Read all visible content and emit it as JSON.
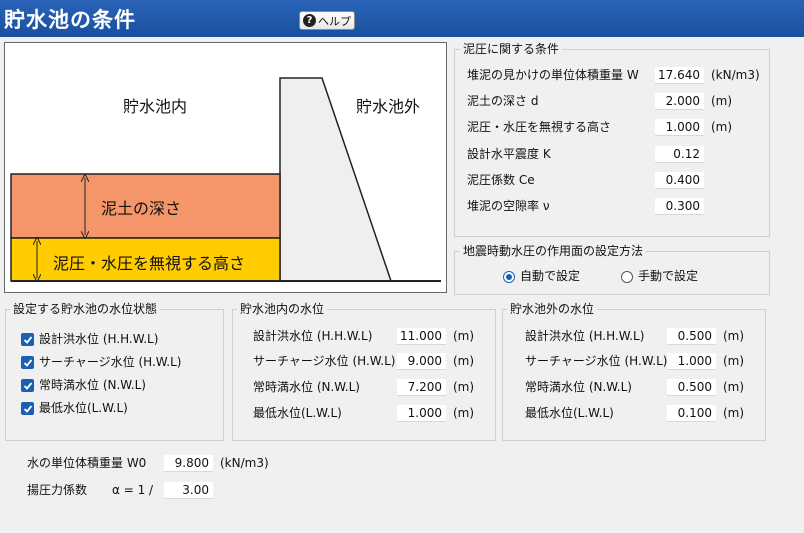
{
  "title": "貯水池の条件",
  "help_label": "ヘルプ",
  "diagram": {
    "inside_label": "貯水池内",
    "outside_label": "貯水池外",
    "mud_depth_label": "泥土の深さ",
    "ignore_height_label": "泥圧・水圧を無視する高さ",
    "colors": {
      "mud": "#f4956a",
      "ignore": "#ffcc00",
      "dam": "#efefef"
    }
  },
  "mud": {
    "legend": "泥圧に関する条件",
    "rows": [
      {
        "label": "堆泥の見かけの単位体積重量 W",
        "value": "17.640",
        "unit": "(kN/m3)"
      },
      {
        "label": "泥土の深さ d",
        "value": "2.000",
        "unit": "(m)"
      },
      {
        "label": "泥圧・水圧を無視する高さ",
        "value": "1.000",
        "unit": "(m)"
      },
      {
        "label": "設計水平震度 K",
        "value": "0.12",
        "unit": ""
      },
      {
        "label": "泥圧係数 Ce",
        "value": "0.400",
        "unit": ""
      },
      {
        "label": "堆泥の空隙率 ν",
        "value": "0.300",
        "unit": ""
      }
    ]
  },
  "seismic": {
    "legend": "地震時動水圧の作用面の設定方法",
    "auto_label": "自動で設定",
    "manual_label": "手動で設定",
    "selected": "auto"
  },
  "level_state": {
    "legend": "設定する貯水池の水位状態",
    "items": [
      {
        "label": "設計洪水位 (H.H.W.L)",
        "checked": true
      },
      {
        "label": "サーチャージ水位 (H.W.L)",
        "checked": true
      },
      {
        "label": "常時満水位 (N.W.L)",
        "checked": true
      },
      {
        "label": "最低水位(L.W.L)",
        "checked": true
      }
    ]
  },
  "inner_level": {
    "legend": "貯水池内の水位",
    "rows": [
      {
        "label": "設計洪水位 (H.H.W.L)",
        "value": "11.000",
        "unit": "(m)"
      },
      {
        "label": "サーチャージ水位 (H.W.L)",
        "value": "9.000",
        "unit": "(m)"
      },
      {
        "label": "常時満水位 (N.W.L)",
        "value": "7.200",
        "unit": "(m)"
      },
      {
        "label": "最低水位(L.W.L)",
        "value": "1.000",
        "unit": "(m)"
      }
    ]
  },
  "outer_level": {
    "legend": "貯水池外の水位",
    "rows": [
      {
        "label": "設計洪水位 (H.H.W.L)",
        "value": "0.500",
        "unit": "(m)"
      },
      {
        "label": "サーチャージ水位 (H.W.L)",
        "value": "1.000",
        "unit": "(m)"
      },
      {
        "label": "常時満水位 (N.W.L)",
        "value": "0.500",
        "unit": "(m)"
      },
      {
        "label": "最低水位(L.W.L)",
        "value": "0.100",
        "unit": "(m)"
      }
    ]
  },
  "water_unit_weight": {
    "label": "水の単位体積重量 W0",
    "value": "9.800",
    "unit": "(kN/m3)"
  },
  "uplift": {
    "label": "揚圧力係数",
    "alpha_label": "α = 1 /",
    "value": "3.00"
  },
  "theme": {
    "titlebar": "#1a4f9e",
    "accent": "#1a5fb4"
  }
}
